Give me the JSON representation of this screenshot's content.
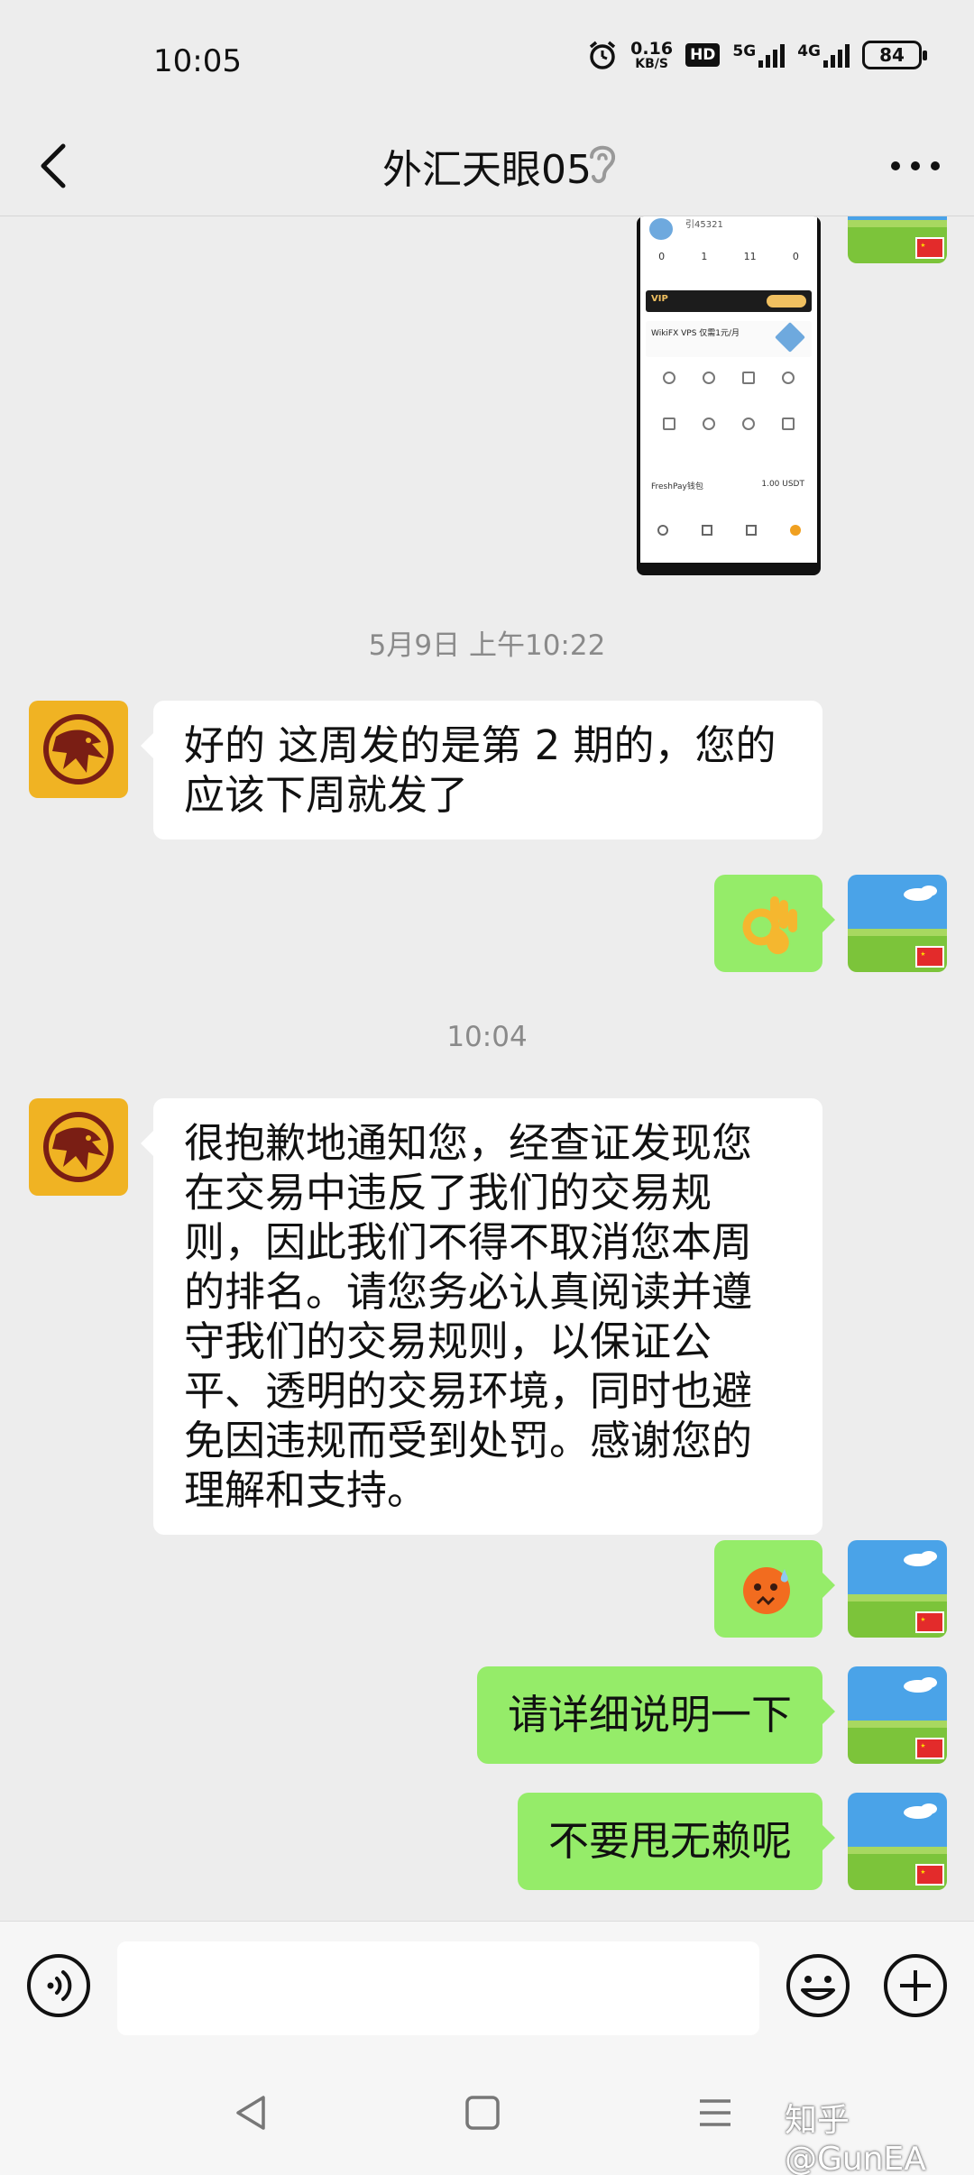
{
  "status_bar": {
    "time": "10:05",
    "speed_value": "0.16",
    "speed_unit": "KB/S",
    "hd_badge": "HD",
    "network_1": "5G",
    "network_2": "4G",
    "battery": "84"
  },
  "header": {
    "title": "外汇天眼05"
  },
  "messages": {
    "ts1": "5月9日 上午10:22",
    "m1_text": "好的 这周发的是第 2 期的，您的应该下周就发了",
    "m2_emoji": "ok-hand-emoji",
    "ts2": "10:04",
    "m3_text": "很抱歉地通知您，经查证发现您在交易中违反了我们的交易规则，因此我们不得不取消您本周的排名。请您务必认真阅读并遵守我们的交易规则，以保证公平、透明的交易环境，同时也避免因违规而受到处罚。感谢您的理解和支持。",
    "m4_emoji": "sweat-face-emoji",
    "m5_text": "请详细说明一下",
    "m6_text": "不要甩无赖呢"
  },
  "screenshot_thumb": {
    "user_id": "引45321",
    "stats": [
      "0",
      "1",
      "11",
      "0"
    ],
    "vip_label": "VIP",
    "vps_title": "WikiFX VPS 仅需1元/月",
    "pay_label": "FreshPay钱包",
    "balance": "1.00 USDT"
  },
  "input": {
    "placeholder": ""
  },
  "watermark": "知乎 @GunEA",
  "colors": {
    "background": "#ededed",
    "sent_bubble": "#95ec69",
    "received_bubble": "#ffffff",
    "agent_avatar": "#f0b323"
  }
}
